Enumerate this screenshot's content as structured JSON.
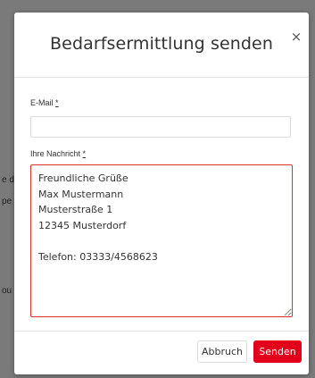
{
  "background": {
    "snippets": [
      "e d",
      "pe",
      "ou"
    ]
  },
  "modal": {
    "title": "Bedarfsermittlung senden",
    "close_symbol": "×",
    "email": {
      "label": "E-Mail",
      "required_mark": "*",
      "value": "",
      "placeholder": ""
    },
    "message": {
      "label": "Ihre Nachricht",
      "required_mark": "*",
      "value": "Freundliche Grüße\nMax Mustermann\nMusterstraße 1\n12345 Musterdorf\n\nTelefon: 03333/4568623"
    },
    "buttons": {
      "cancel": "Abbruch",
      "send": "Senden"
    }
  },
  "colors": {
    "accent_red": "#e2001a",
    "error_border": "#d9342b",
    "backdrop": "#7a7a7a"
  },
  "icons": {
    "close": "close-icon",
    "resize": "resize-grip-icon"
  }
}
